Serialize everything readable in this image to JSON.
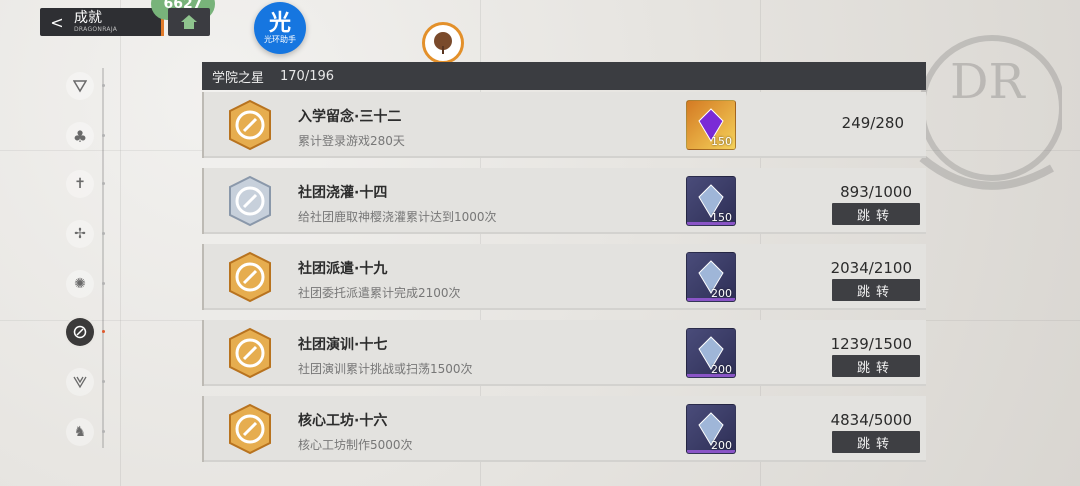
{
  "header": {
    "title": "成就",
    "subtitle": "DRAGONRAJA",
    "back_label": "<",
    "counter_badge": "6627"
  },
  "helper": {
    "big": "光",
    "small": "光环助手"
  },
  "section": {
    "title": "学院之星",
    "count": "170/196"
  },
  "sidebar": {
    "items": [
      {
        "icon": "triangle-icon"
      },
      {
        "icon": "club-icon"
      },
      {
        "icon": "sword-icon"
      },
      {
        "icon": "bird-icon"
      },
      {
        "icon": "atom-icon"
      },
      {
        "icon": "compass-icon",
        "active": true
      },
      {
        "icon": "wing-icon"
      },
      {
        "icon": "crest-icon"
      }
    ]
  },
  "cards": [
    {
      "name": "入学留念·三十二",
      "desc": "累计登录游戏280天",
      "reward_qty": "150",
      "reward_type": "orange",
      "progress": "249/280",
      "has_jump": false,
      "jump_label": ""
    },
    {
      "name": "社团浇灌·十四",
      "desc": "给社团鹿取神樱浇灌累计达到1000次",
      "reward_qty": "150",
      "reward_type": "blue",
      "progress": "893/1000",
      "has_jump": true,
      "jump_label": "跳转"
    },
    {
      "name": "社团派遣·十九",
      "desc": "社团委托派遣累计完成2100次",
      "reward_qty": "200",
      "reward_type": "blue",
      "progress": "2034/2100",
      "has_jump": true,
      "jump_label": "跳转"
    },
    {
      "name": "社团演训·十七",
      "desc": "社团演训累计挑战或扫荡1500次",
      "reward_qty": "200",
      "reward_type": "blue",
      "progress": "1239/1500",
      "has_jump": true,
      "jump_label": "跳转"
    },
    {
      "name": "核心工坊·十六",
      "desc": "核心工坊制作5000次",
      "reward_qty": "200",
      "reward_type": "blue",
      "progress": "4834/5000",
      "has_jump": true,
      "jump_label": "跳转"
    }
  ],
  "colors": {
    "accent": "#e07a2a",
    "dark": "#3b3d41",
    "card": "#e3e2df"
  }
}
